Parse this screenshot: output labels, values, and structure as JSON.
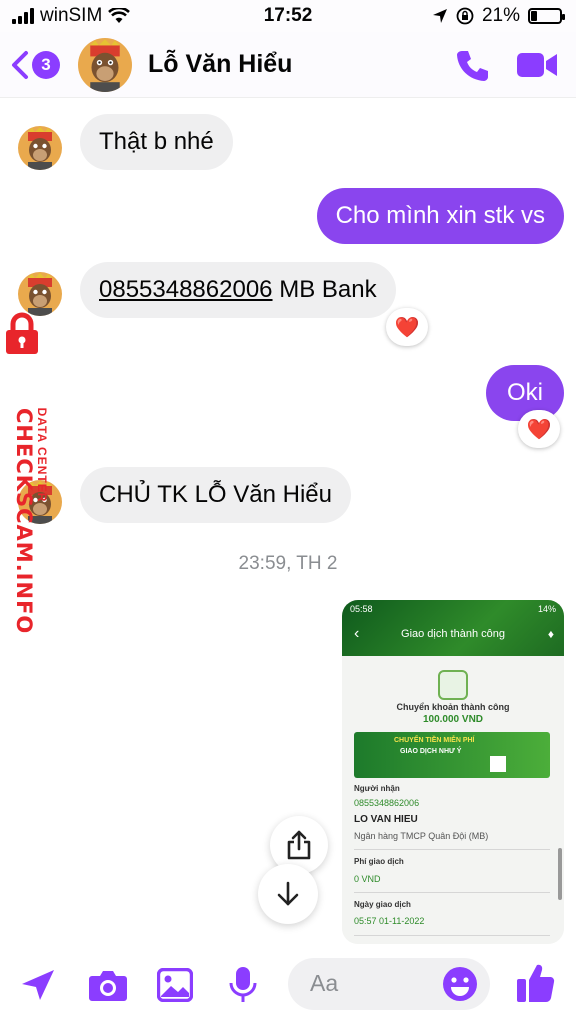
{
  "status_bar": {
    "carrier": "winSIM",
    "time": "17:52",
    "battery": "21%",
    "icons": [
      "signal-icon",
      "wifi-icon",
      "location-icon",
      "orientation-lock-icon",
      "battery-icon"
    ]
  },
  "header": {
    "unread_count": "3",
    "contact_name": "Lỗ Văn Hiểu",
    "icons": [
      "back-chevron-icon",
      "phone-icon",
      "video-camera-icon"
    ]
  },
  "messages": [
    {
      "direction": "incoming",
      "text": "Thật b nhé"
    },
    {
      "direction": "outgoing",
      "text": "Cho mình xin stk vs"
    },
    {
      "direction": "incoming",
      "account": "0855348862006",
      "text": " MB Bank",
      "reaction": "❤️"
    },
    {
      "direction": "outgoing",
      "text": "Oki",
      "reaction": "❤️"
    },
    {
      "direction": "incoming",
      "text": "CHỦ TK LỖ Văn Hiểu"
    }
  ],
  "timestamp": "23:59, TH 2",
  "watermark": {
    "brand": "CHECKSCAM.INFO",
    "tagline": "DATA CENTER"
  },
  "shared_screenshot": {
    "status_time": "05:58",
    "status_battery": "14%",
    "title": "Giao dịch thành công",
    "success_text": "Chuyển khoản thành công",
    "amount": "100.000 VND",
    "banner_line1": "CHUYỂN TIỀN MIỄN PHÍ",
    "banner_line2": "GIAO DỊCH NHƯ Ý",
    "recipient_label": "Người nhận",
    "recipient_account": "0855348862006",
    "recipient_name": "LO VAN HIEU",
    "recipient_bank": "Ngân hàng TMCP Quân Đội (MB)",
    "fee_label": "Phí giao dịch",
    "fee_value": "0 VND",
    "date_label": "Ngày giao dịch",
    "date_value": "05:57 01-11-2022"
  },
  "composer": {
    "placeholder": "Aa",
    "icons": [
      "send-arrow-icon",
      "camera-icon",
      "gallery-icon",
      "microphone-icon",
      "emoji-icon",
      "thumbs-up-icon"
    ]
  },
  "colors": {
    "accent": "#8a45ee",
    "incoming_bubble": "#efeff0",
    "watermark_red": "#e8252b",
    "bank_green": "#2e8b2a"
  }
}
